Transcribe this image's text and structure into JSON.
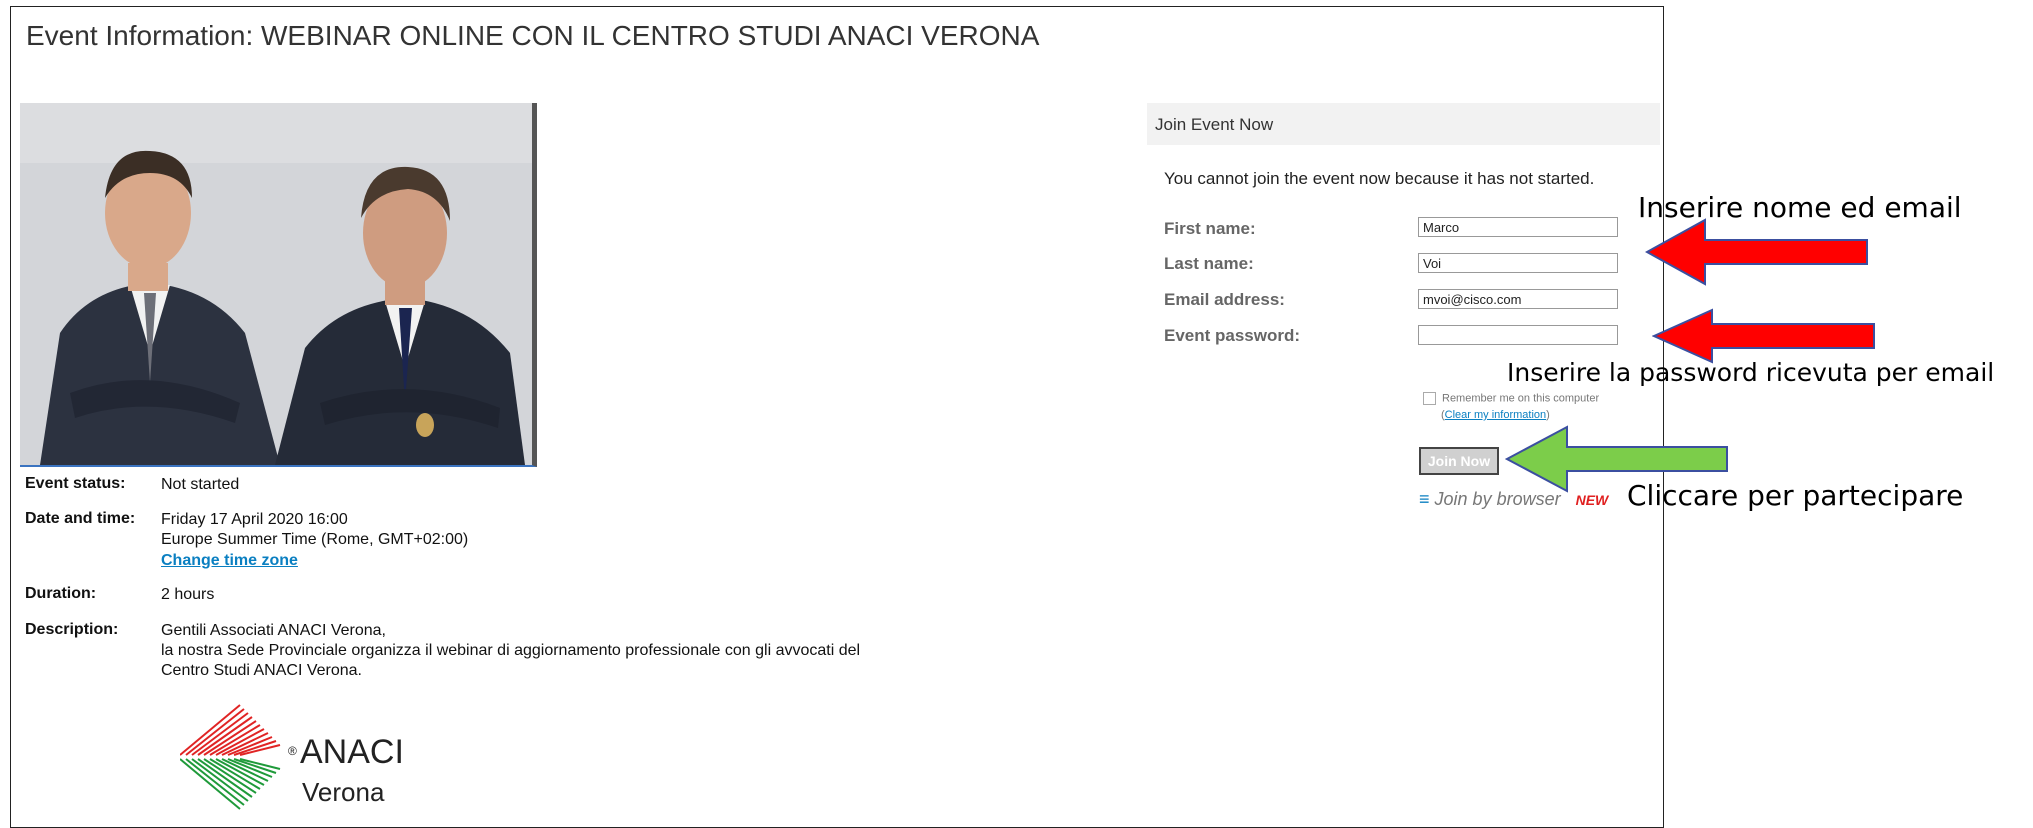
{
  "page": {
    "title": "Event Information: WEBINAR ONLINE CON IL CENTRO STUDI ANACI VERONA"
  },
  "event": {
    "status_label": "Event status:",
    "status_value": "Not started",
    "datetime_label": "Date and time:",
    "datetime_line1": "Friday 17 April 2020 16:00",
    "datetime_line2": "Europe Summer Time (Rome, GMT+02:00)",
    "change_tz": "Change time zone",
    "duration_label": "Duration:",
    "duration_value": "2 hours",
    "description_label": "Description:",
    "description_line1": "Gentili Associati ANACI Verona,",
    "description_line2": "la nostra Sede Provinciale organizza il webinar di aggiornamento professionale con gli avvocati del",
    "description_line3": "Centro Studi ANACI Verona."
  },
  "logo": {
    "name": "ANACI",
    "city": "Verona",
    "registered": "®"
  },
  "join": {
    "header": "Join Event Now",
    "notice": "You cannot join the event now because it has not started.",
    "first_name_label": "First name:",
    "first_name_value": "Marco",
    "last_name_label": "Last name:",
    "last_name_value": "Voi",
    "email_label": "Email address:",
    "email_value": "mvoi@cisco.com",
    "password_label": "Event password:",
    "password_value": "",
    "remember_label": "Remember me on this computer",
    "clear_info": "Clear my information",
    "clear_open": "(",
    "clear_close": ")",
    "join_button": "Join Now",
    "join_browser": "Join by browser",
    "new_badge": "NEW"
  },
  "annotations": {
    "name_email": "Inserire nome ed email",
    "password": "Inserire la password ricevuta per email",
    "click": "Cliccare per partecipare"
  },
  "colors": {
    "red_arrow": "#ff0000",
    "green_arrow": "#7ccd4a",
    "link": "#0a7fc1",
    "new": "#e02020"
  }
}
